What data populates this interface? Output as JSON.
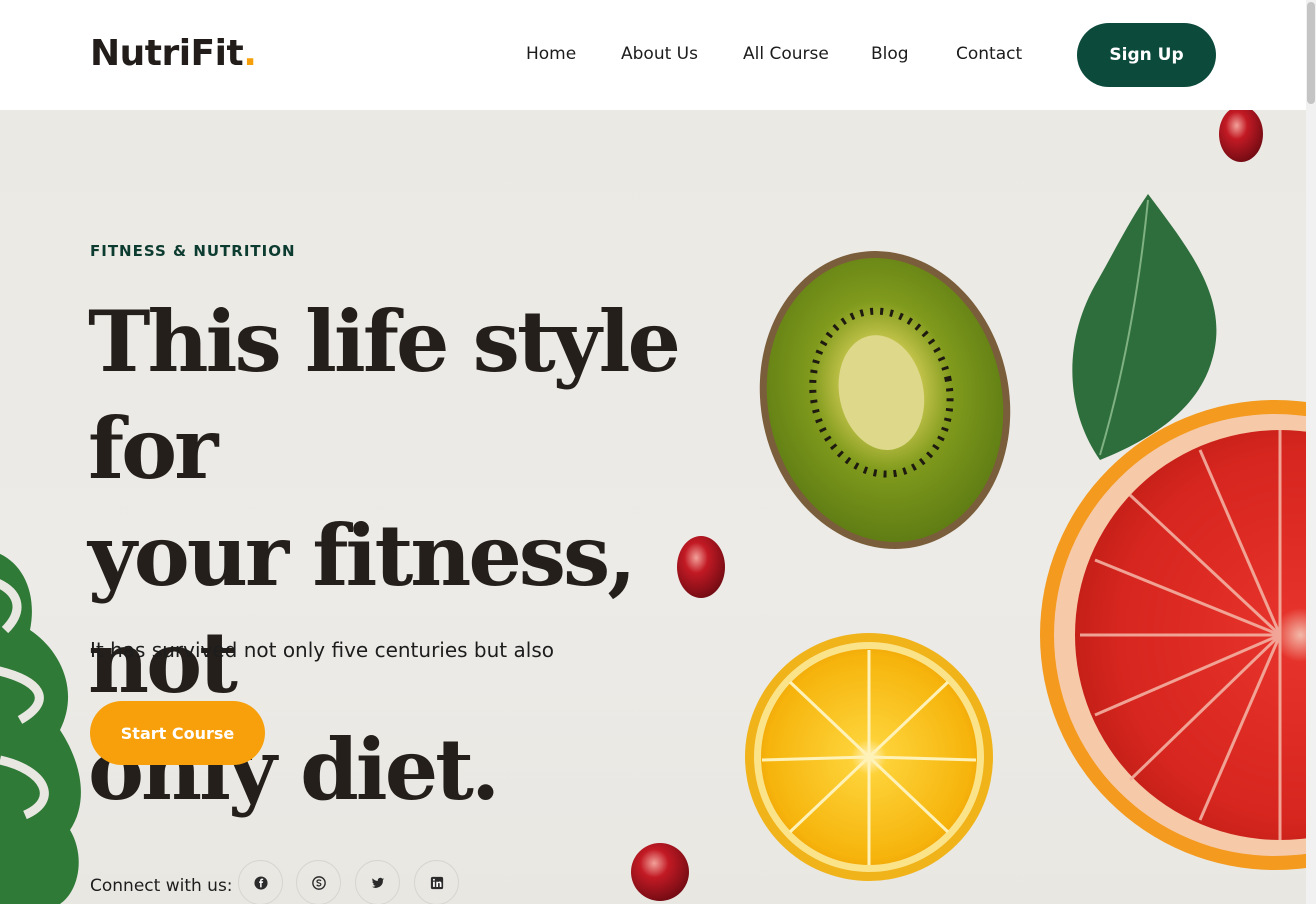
{
  "header": {
    "logo_text": "NutriFit",
    "logo_dot": ".",
    "nav": [
      {
        "label": "Home"
      },
      {
        "label": "About Us"
      },
      {
        "label": "All Course"
      },
      {
        "label": "Blog"
      },
      {
        "label": "Contact"
      }
    ],
    "signup_label": "Sign Up"
  },
  "hero": {
    "eyebrow": "FITNESS & NUTRITION",
    "headline_lines": [
      "This life style for",
      "your fitness, not",
      "only diet."
    ],
    "subtext": "It has survived not only five centuries but also",
    "cta_label": "Start Course",
    "connect_label": "Connect with us:",
    "social_icons": [
      "facebook-icon",
      "skype-icon",
      "twitter-icon",
      "linkedin-icon"
    ]
  },
  "colors": {
    "brand_dark": "#0c4a3c",
    "accent": "#f8a00c",
    "heading": "#241f1b",
    "hero_bg": "#ebe9e4"
  }
}
